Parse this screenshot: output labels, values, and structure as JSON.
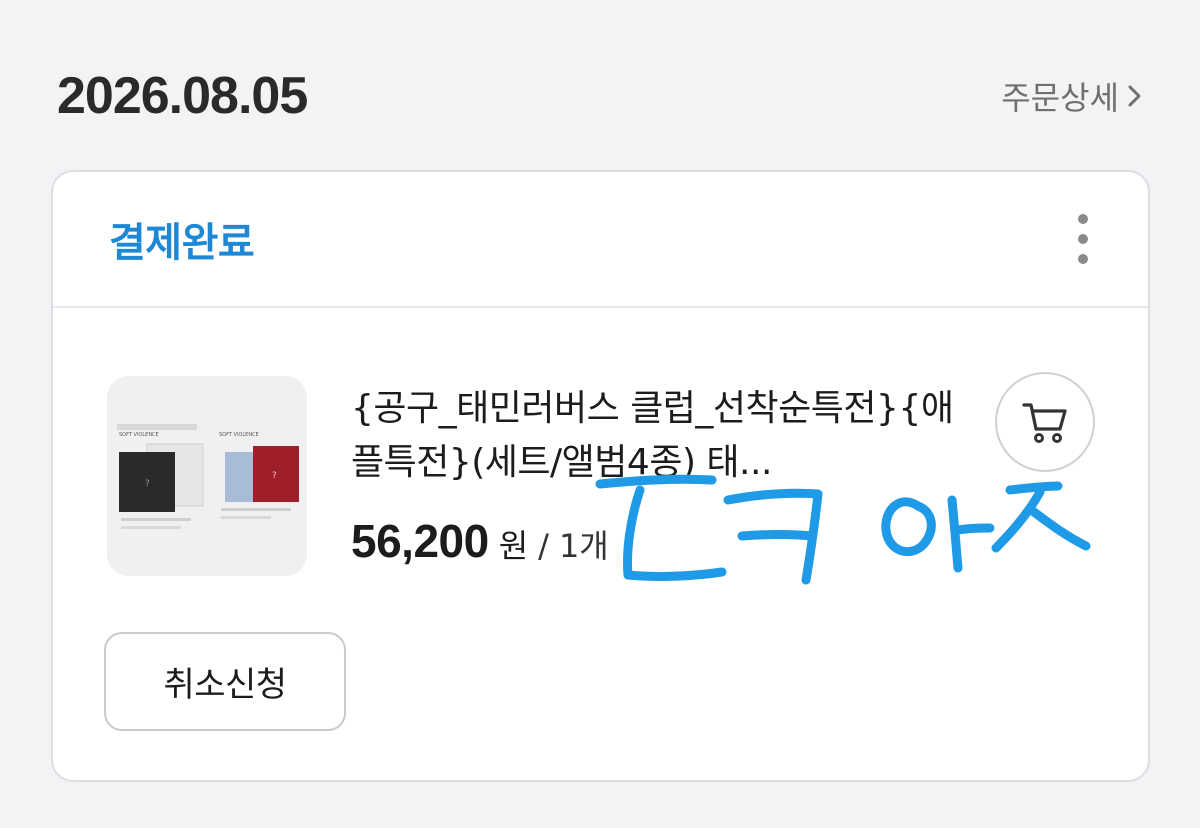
{
  "order": {
    "date": "2026.08.05",
    "detail_link_label": "주문상세",
    "status": "결제완료",
    "more_icon": "more-vertical-icon",
    "product": {
      "name": "{공구_태민러버스 클럽_선착순특전}{애플특전}(세트/앨범4종) 태...",
      "price": "56,200",
      "currency_unit": "원",
      "separator": "/",
      "quantity": "1개",
      "thumbnail_icon": "album-cover-image"
    },
    "cart_icon": "cart-icon",
    "cancel_button_label": "취소신청"
  },
  "handwritten_overlay": "Ⅽㅋ 야",
  "colors": {
    "status": "#1e88d6",
    "scribble": "#1e9ae6",
    "text": "#1c1c1c",
    "muted": "#6f6f6f"
  }
}
